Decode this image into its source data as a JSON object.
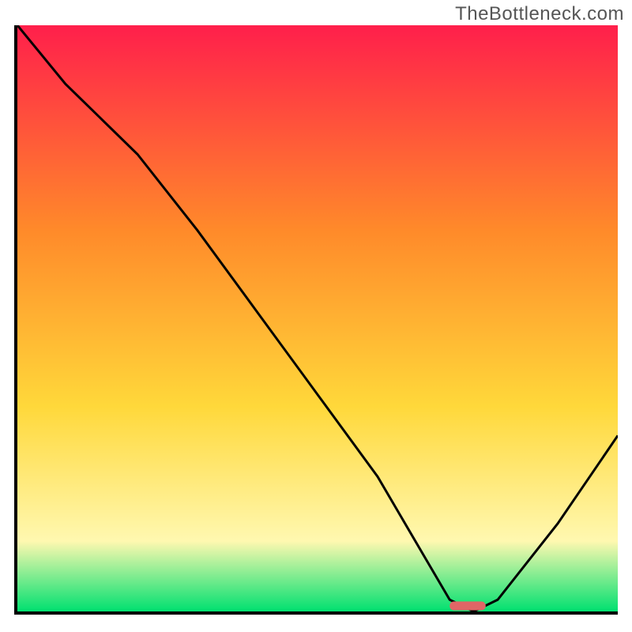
{
  "watermark": "TheBottleneck.com",
  "colors": {
    "gradient_top": "#ff1f4b",
    "gradient_mid1": "#ff8a2a",
    "gradient_mid2": "#ffd83a",
    "gradient_mid3": "#fff8b0",
    "gradient_bottom": "#00e070",
    "curve": "#000000",
    "marker": "#e06666",
    "axis": "#000000"
  },
  "chart_data": {
    "type": "line",
    "title": "",
    "xlabel": "",
    "ylabel": "",
    "xlim": [
      0,
      100
    ],
    "ylim": [
      0,
      100
    ],
    "x": [
      0,
      8,
      20,
      30,
      40,
      50,
      60,
      68,
      72,
      76,
      80,
      90,
      100
    ],
    "values": [
      100,
      90,
      78,
      65,
      51,
      37,
      23,
      9,
      2,
      0,
      2,
      15,
      30
    ],
    "marker": {
      "x_range": [
        72,
        78
      ],
      "y": 0.5
    },
    "annotations": []
  }
}
